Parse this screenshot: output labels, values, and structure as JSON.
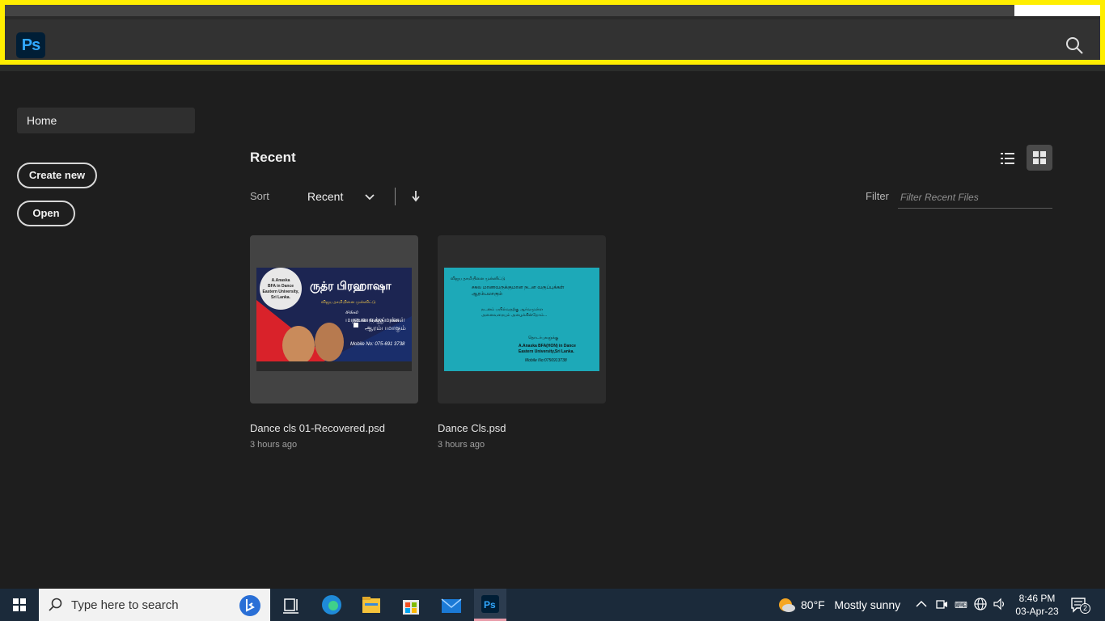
{
  "app": {
    "logo_text": "Ps"
  },
  "sidebar": {
    "home_label": "Home",
    "create_new_label": "Create new",
    "open_label": "Open"
  },
  "main": {
    "title": "Recent",
    "sort_label": "Sort",
    "sort_value": "Recent",
    "filter_label": "Filter",
    "filter_placeholder": "Filter Recent Files",
    "files": [
      {
        "name": "Dance cls 01-Recovered.psd",
        "time": "3 hours ago"
      },
      {
        "name": "Dance Cls.psd",
        "time": "3 hours ago"
      }
    ]
  },
  "thumb1_text": {
    "circle": [
      "A.Anaska",
      "BFA in Dance",
      "Eastern University,",
      "Sri Lanka."
    ],
    "title": "ருத்ர பிரஹாஷா",
    "line1": "விஜய தசமியினை முன்னிட்டு",
    "line2": "சகல மாணவருக்குமான",
    "line3": "நடன வகுப்புக்கள்",
    "line4": "ஆரம்பமாகும்",
    "mobile": "Mobile No: 075-691 3738"
  },
  "thumb2_text": {
    "line1": "விஜய தசமியினை முன்னிட்டு",
    "line2": "சகல மாணவருக்குமான நடன வகுப்புக்கள்",
    "line3": "ஆரம்பமாகும்",
    "line4": "நடனம் பயில்வதற்கு ஆர்வமுள்ள",
    "line5": "அனைவரையும் அழைக்கின்றோம்...",
    "line6": "தொடர்புகளுக்கு",
    "line7": "A.Anaska BFA(HON) in Dance",
    "line8": "Eastern University,Sri Lanka.",
    "line9": "Mobile No:0756913738"
  },
  "taskbar": {
    "search_placeholder": "Type here to search",
    "weather_temp": "80°F",
    "weather_text": "Mostly sunny",
    "time": "8:46 PM",
    "date": "03-Apr-23",
    "notification_count": "2"
  }
}
